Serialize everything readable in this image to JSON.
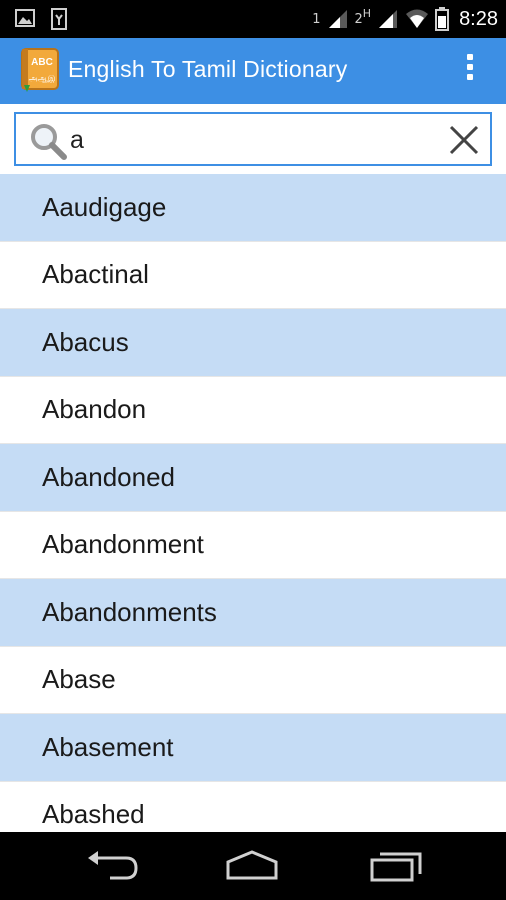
{
  "status_bar": {
    "sim1": "1",
    "sim2": "2",
    "network": "H",
    "time": "8:28",
    "icons": [
      "gallery-icon",
      "usb-debug-icon",
      "signal-1-icon",
      "signal-2-icon",
      "wifi-icon",
      "battery-icon"
    ]
  },
  "app_bar": {
    "title": "English To Tamil Dictionary",
    "logo": {
      "top_text": "ABC",
      "bottom_text": "அஆஇ"
    },
    "accent_color": "#3d8fe4"
  },
  "search": {
    "value": "a",
    "placeholder": ""
  },
  "words": [
    "Aaudigage",
    "Abactinal",
    "Abacus",
    "Abandon",
    "Abandoned",
    "Abandonment",
    "Abandonments",
    "Abase",
    "Abasement",
    "Abashed"
  ],
  "colors": {
    "row_alt": "#c5dcf5",
    "row_default": "#ffffff"
  },
  "nav_bar": {
    "icons": [
      "back-icon",
      "home-icon",
      "recents-icon"
    ]
  }
}
